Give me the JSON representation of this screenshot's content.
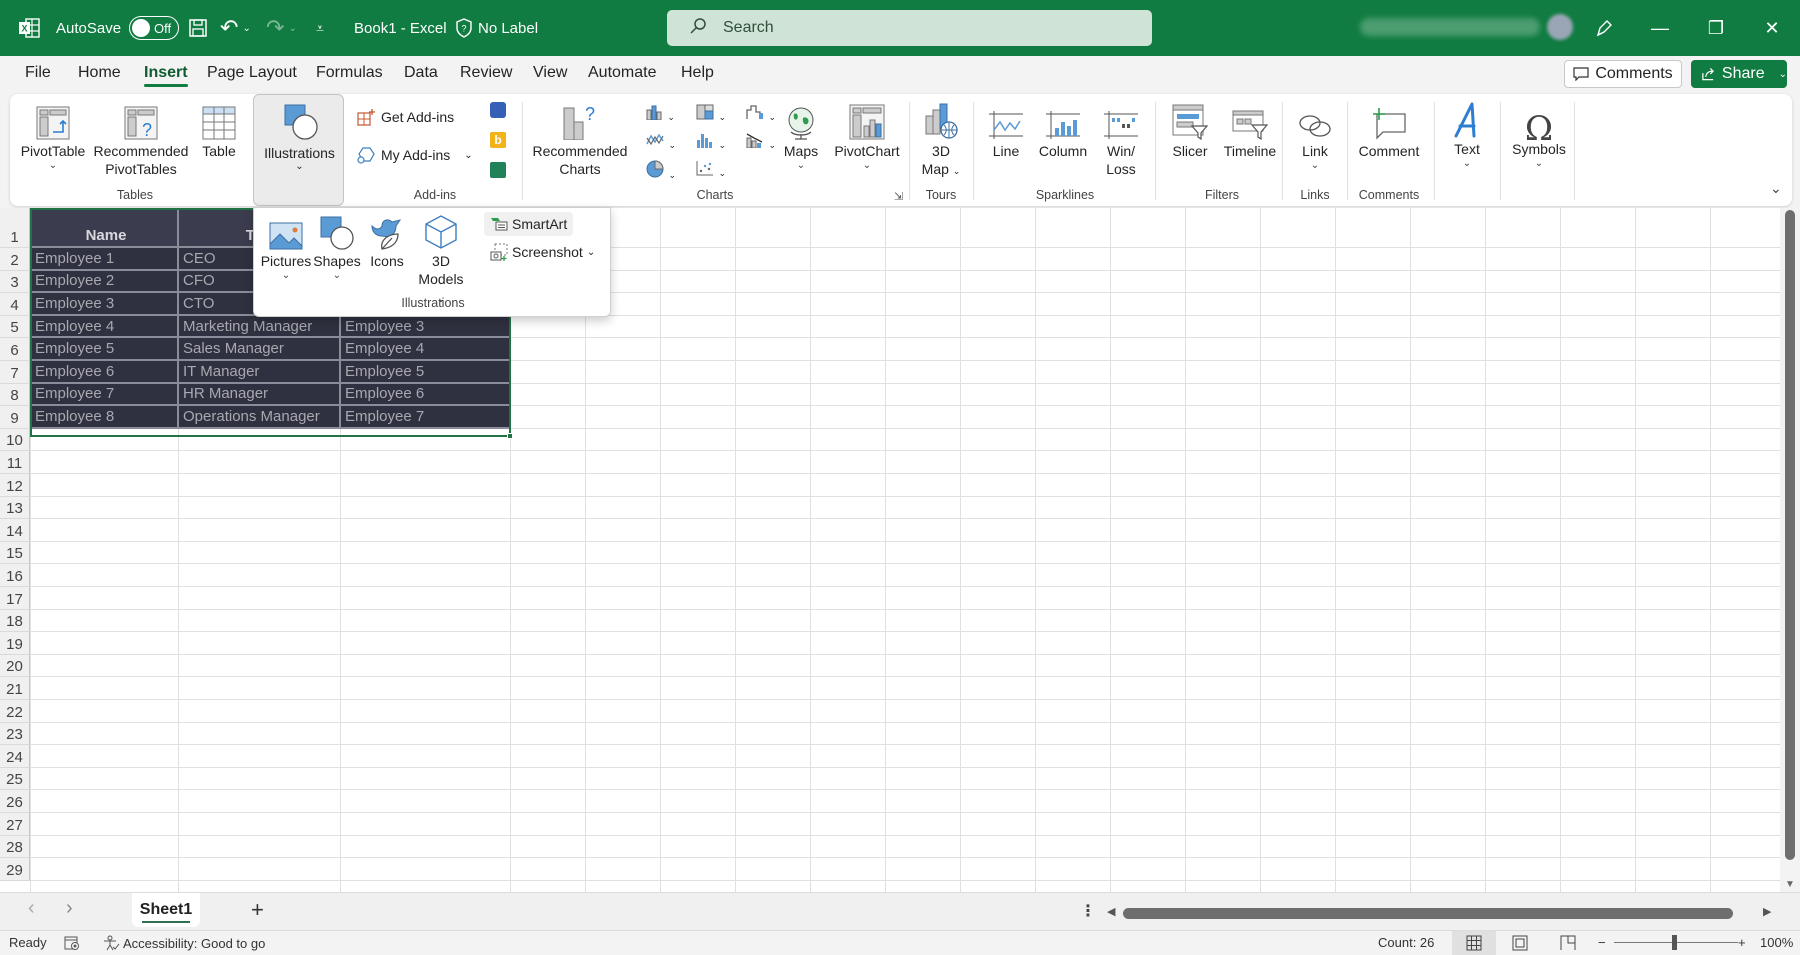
{
  "titlebar": {
    "autosave_label": "AutoSave",
    "autosave_state": "Off",
    "doc_title": "Book1  -  Excel",
    "sensitivity_label": "No Label",
    "search_placeholder": "Search",
    "icons": {
      "app": "excel-logo-icon",
      "save": "save-icon",
      "undo": "undo-icon",
      "redo": "redo-icon",
      "customize": "customize-toolbar-icon",
      "shield": "shield-icon",
      "search": "search-icon",
      "pen": "designer-pen-icon",
      "minimize": "minimize-icon",
      "restore": "restore-icon",
      "close": "close-icon"
    },
    "glyphs": {
      "minimize": "—",
      "restore": "❐",
      "close": "✕",
      "search": "⚲",
      "undo": "↶",
      "redo": "↷"
    }
  },
  "menu": {
    "tabs": [
      "File",
      "Home",
      "Insert",
      "Page Layout",
      "Formulas",
      "Data",
      "Review",
      "View",
      "Automate",
      "Help"
    ],
    "active_tab": "Insert",
    "comments_label": "Comments",
    "share_label": "Share"
  },
  "ribbon": {
    "groups": {
      "tables": "Tables",
      "addins": "Add-ins",
      "charts": "Charts",
      "tours": "Tours",
      "sparklines": "Sparklines",
      "filters": "Filters",
      "links": "Links",
      "comments": "Comments"
    },
    "buttons": {
      "pivottable": "PivotTable",
      "recommended_pivottables_1": "Recommended",
      "recommended_pivottables_2": "PivotTables",
      "table": "Table",
      "illustrations": "Illustrations",
      "get_addins": "Get Add-ins",
      "my_addins": "My Add-ins",
      "recommended_charts_1": "Recommended",
      "recommended_charts_2": "Charts",
      "maps": "Maps",
      "pivotchart": "PivotChart",
      "map3d_1": "3D",
      "map3d_2": "Map",
      "line": "Line",
      "column": "Column",
      "winloss_1": "Win/",
      "winloss_2": "Loss",
      "slicer": "Slicer",
      "timeline": "Timeline",
      "link": "Link",
      "comment": "Comment",
      "text": "Text",
      "symbols": "Symbols"
    }
  },
  "illustrations_dropdown": {
    "group_label": "Illustrations",
    "items": {
      "pictures": "Pictures",
      "shapes": "Shapes",
      "icons": "Icons",
      "models_1": "3D",
      "models_2": "Models",
      "smartart": "SmartArt",
      "screenshot": "Screenshot"
    }
  },
  "sheet": {
    "row_numbers": [
      "1",
      "2",
      "3",
      "4",
      "5",
      "6",
      "7",
      "8",
      "9",
      "10",
      "11",
      "12",
      "13",
      "14",
      "15",
      "16",
      "17",
      "18",
      "19",
      "20",
      "21",
      "22",
      "23",
      "24",
      "25",
      "26",
      "27",
      "28",
      "29"
    ],
    "table": {
      "headers": [
        "Name",
        "Title",
        ""
      ],
      "rows": [
        [
          "Employee 1",
          "CEO",
          ""
        ],
        [
          "Employee 2",
          "CFO",
          ""
        ],
        [
          "Employee 3",
          "CTO",
          ""
        ],
        [
          "Employee 4",
          "Marketing Manager",
          "Employee 3"
        ],
        [
          "Employee 5",
          "Sales Manager",
          "Employee 4"
        ],
        [
          "Employee 6",
          "IT Manager",
          "Employee 5"
        ],
        [
          "Employee 7",
          "HR Manager",
          "Employee 6"
        ],
        [
          "Employee 8",
          "Operations Manager",
          "Employee 7"
        ]
      ]
    },
    "colors": {
      "table_body": "#2f3140",
      "table_header": "#3b3d4e",
      "accent": "#107c41"
    }
  },
  "sheetbar": {
    "active_sheet": "Sheet1",
    "add_sheet": "+",
    "prev": "‹",
    "next": "›"
  },
  "status": {
    "ready": "Ready",
    "accessibility": "Accessibility: Good to go",
    "count": "Count: 26",
    "zoom": "100%",
    "zoom_minus": "−",
    "zoom_plus": "+"
  }
}
